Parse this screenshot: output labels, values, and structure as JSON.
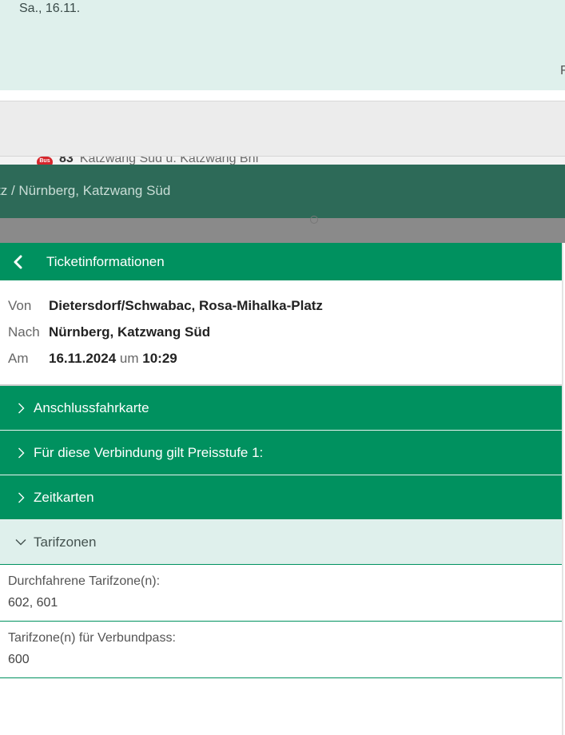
{
  "background": {
    "date": "Sa., 16.11.",
    "edge_glyph": "F",
    "line_badge": "Bus",
    "line_number": "83",
    "line_text": "Katzwang Süd ü. Katzwang Bhf",
    "route_banner": "tz / Nürnberg, Katzwang Süd"
  },
  "header": {
    "title": "Ticketinformationen",
    "back_icon": "chevron-left-icon"
  },
  "trip": {
    "von_label": "Von",
    "von_value": "Dietersdorf/Schwabac, Rosa-Mihalka-Platz",
    "nach_label": "Nach",
    "nach_value": "Nürnberg, Katzwang Süd",
    "am_label": "Am",
    "date": "16.11.2024",
    "um_label": "um",
    "time": "10:29"
  },
  "accordion": [
    {
      "label": "Anschlussfahrkarte",
      "expanded": false
    },
    {
      "label": "Für diese Verbindung gilt Preisstufe 1:",
      "expanded": false
    },
    {
      "label": "Zeitkarten",
      "expanded": false
    },
    {
      "label": "Tarifzonen",
      "expanded": true
    }
  ],
  "tarifzonen": {
    "durchfahrene_label": "Durchfahrene Tarifzone(n):",
    "durchfahrene_value": "602, 601",
    "verbundpass_label": "Tarifzone(n) für Verbundpass:",
    "verbundpass_value": "600"
  },
  "colors": {
    "primary_green": "#00915f",
    "dark_green": "#2d6a58",
    "mint": "#dff0ec",
    "bus_red": "#d6262c"
  }
}
